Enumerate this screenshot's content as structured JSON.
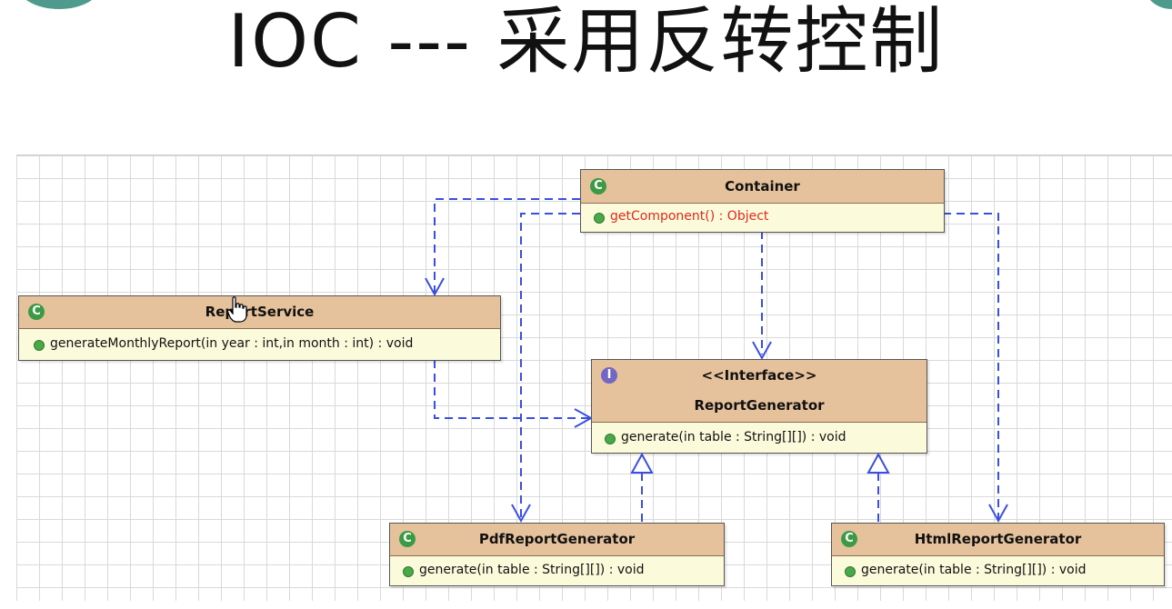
{
  "title": "IOC --- 采用反转控制",
  "colors": {
    "header_fill": "#e6c29c",
    "body_fill": "#fbfbdc",
    "class_badge": "#3c9a46",
    "interface_badge": "#7466c4",
    "arrow": "#3a4fe0",
    "highlight_method": "#e2281b",
    "corner_accent": "#4e9a8c"
  },
  "classes": {
    "container": {
      "badge": "C",
      "name": "Container",
      "method": "getComponent() : Object"
    },
    "report_service": {
      "badge": "C",
      "name": "ReportService",
      "method": "generateMonthlyReport(in year : int,in month : int) : void"
    },
    "report_generator": {
      "badge": "I",
      "stereotype": "<<Interface>>",
      "name": "ReportGenerator",
      "method": "generate(in table : String[][]) : void"
    },
    "pdf_report_generator": {
      "badge": "C",
      "name": "PdfReportGenerator",
      "method": "generate(in table : String[][]) : void"
    },
    "html_report_generator": {
      "badge": "C",
      "name": "HtmlReportGenerator",
      "method": "generate(in table : String[][]) : void"
    }
  },
  "relations": [
    {
      "from": "Container",
      "to": "ReportService",
      "kind": "dependency"
    },
    {
      "from": "Container",
      "to": "ReportGenerator",
      "kind": "dependency"
    },
    {
      "from": "Container",
      "to": "PdfReportGenerator",
      "kind": "dependency"
    },
    {
      "from": "Container",
      "to": "HtmlReportGenerator",
      "kind": "dependency"
    },
    {
      "from": "ReportService",
      "to": "ReportGenerator",
      "kind": "dependency"
    },
    {
      "from": "PdfReportGenerator",
      "to": "ReportGenerator",
      "kind": "realization"
    },
    {
      "from": "HtmlReportGenerator",
      "to": "ReportGenerator",
      "kind": "realization"
    }
  ]
}
